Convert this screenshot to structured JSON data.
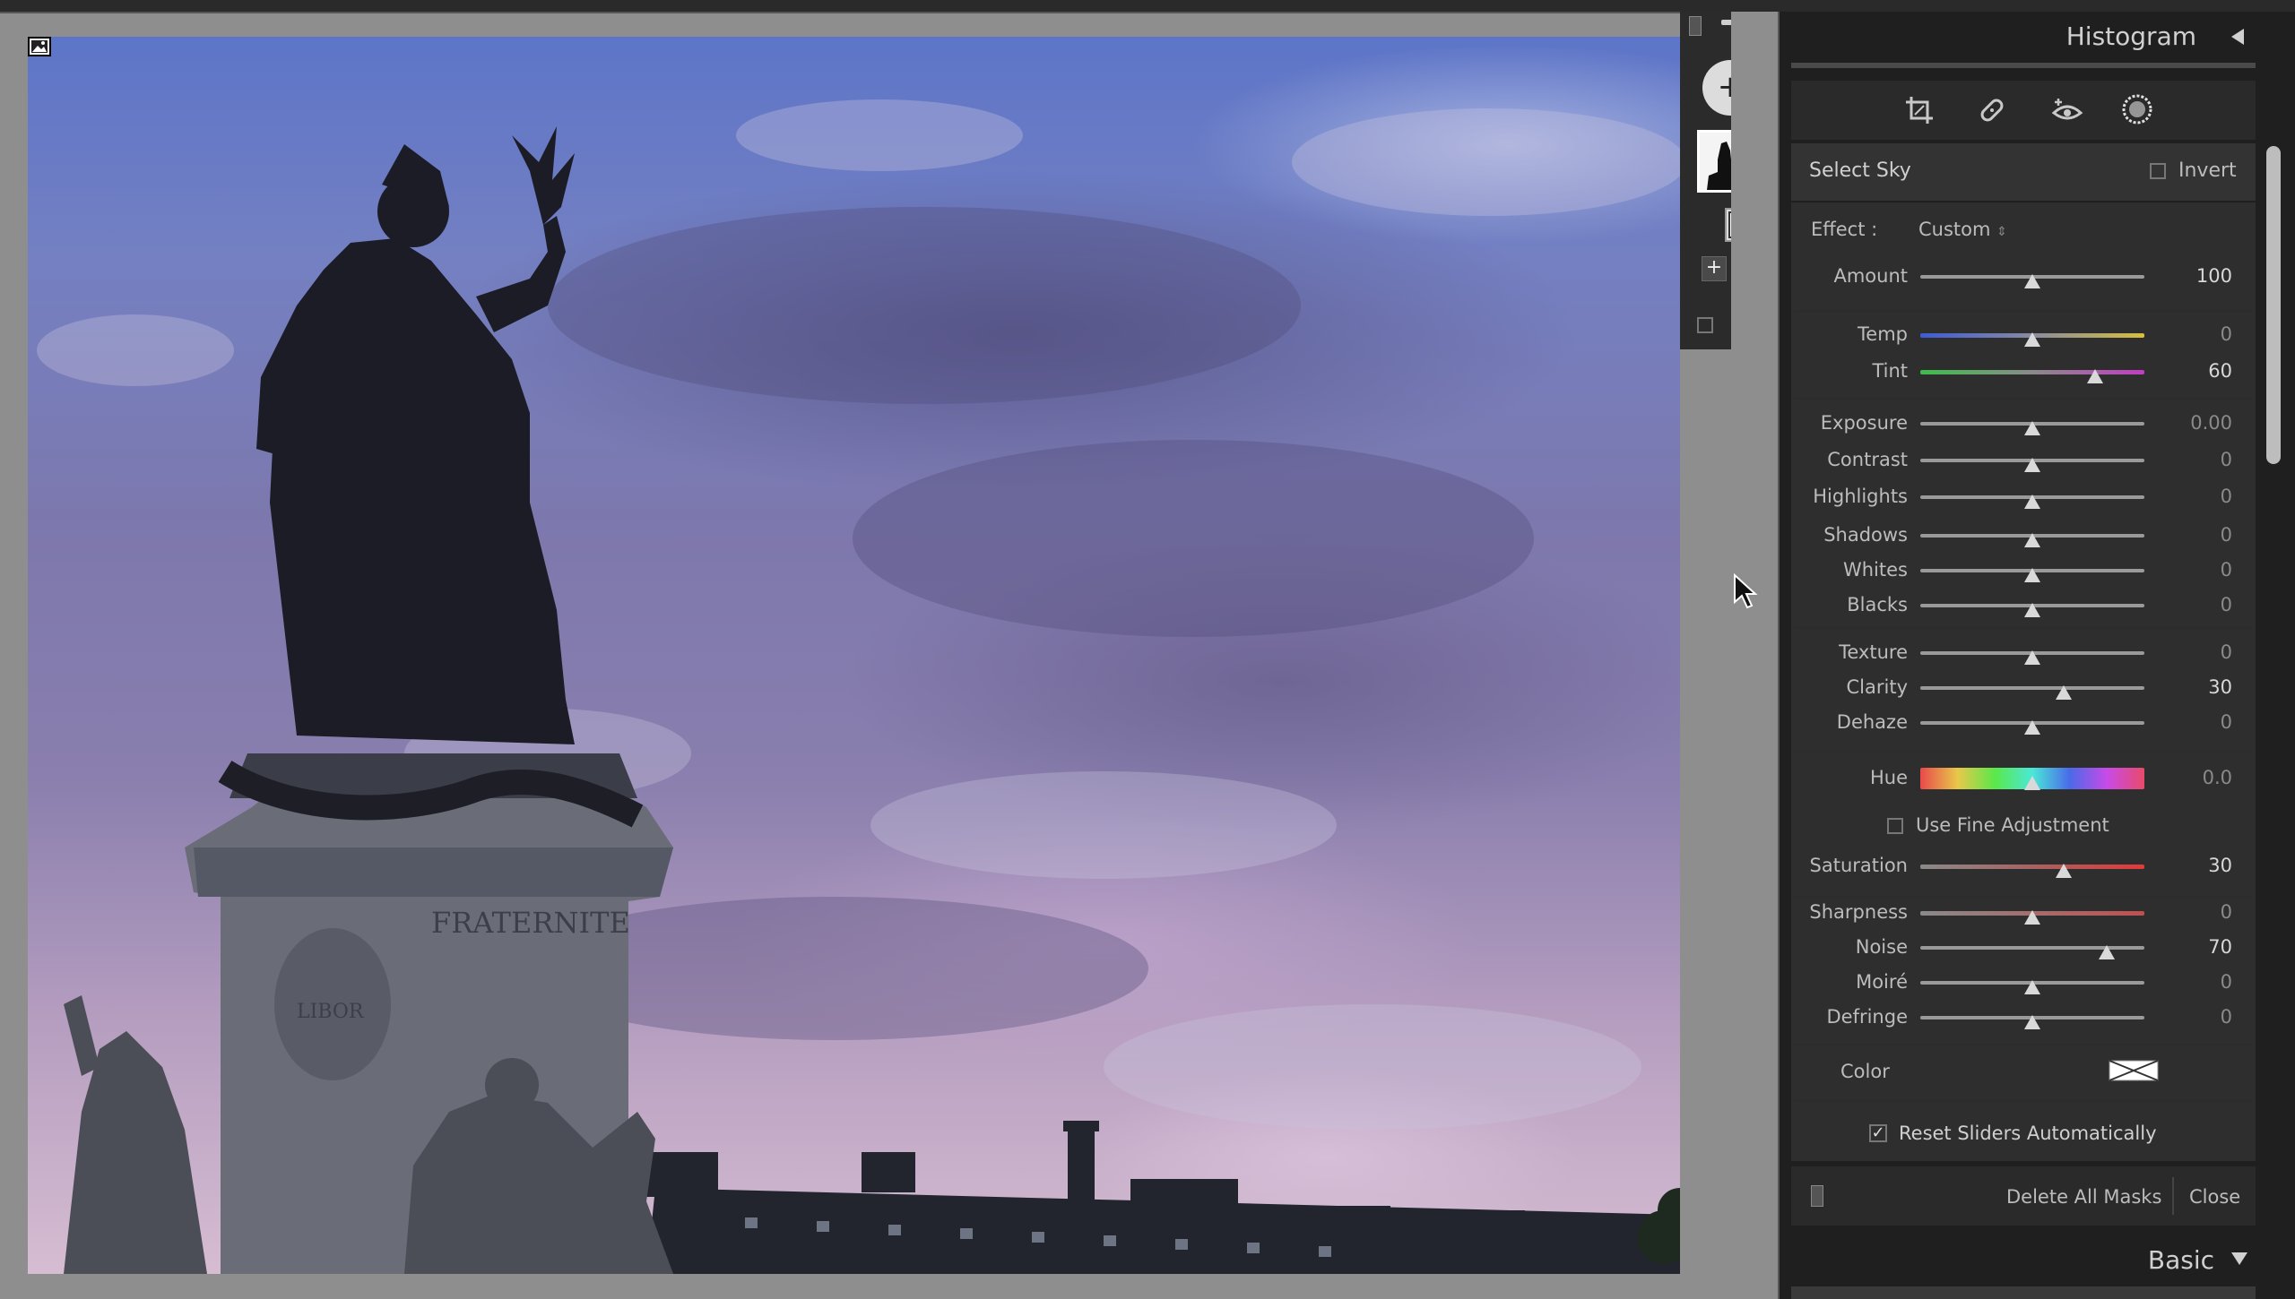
{
  "header": {
    "histogram_label": "Histogram",
    "basic_label": "Basic"
  },
  "mask": {
    "select_sky_label": "Select Sky",
    "invert_label": "Invert",
    "effect_label": "Effect :",
    "effect_value": "Custom"
  },
  "sliders": [
    {
      "label": "Amount",
      "value": "100",
      "pos": 0.5,
      "track": "gray"
    },
    {
      "label": "Temp",
      "value": "0",
      "pos": 0.5,
      "track": "temp"
    },
    {
      "label": "Tint",
      "value": "60",
      "pos": 0.78,
      "track": "tint"
    },
    {
      "label": "Exposure",
      "value": "0.00",
      "pos": 0.5,
      "track": "gray"
    },
    {
      "label": "Contrast",
      "value": "0",
      "pos": 0.5,
      "track": "gray"
    },
    {
      "label": "Highlights",
      "value": "0",
      "pos": 0.5,
      "track": "gray"
    },
    {
      "label": "Shadows",
      "value": "0",
      "pos": 0.5,
      "track": "gray"
    },
    {
      "label": "Whites",
      "value": "0",
      "pos": 0.5,
      "track": "gray"
    },
    {
      "label": "Blacks",
      "value": "0",
      "pos": 0.5,
      "track": "gray"
    },
    {
      "label": "Texture",
      "value": "0",
      "pos": 0.5,
      "track": "gray"
    },
    {
      "label": "Clarity",
      "value": "30",
      "pos": 0.64,
      "track": "gray"
    },
    {
      "label": "Dehaze",
      "value": "0",
      "pos": 0.5,
      "track": "gray"
    },
    {
      "label": "Hue",
      "value": "0.0",
      "pos": 0.5,
      "track": "hue"
    },
    {
      "label": "Saturation",
      "value": "30",
      "pos": 0.64,
      "track": "sat"
    },
    {
      "label": "Sharpness",
      "value": "0",
      "pos": 0.5,
      "track": "sharp"
    },
    {
      "label": "Noise",
      "value": "70",
      "pos": 0.83,
      "track": "gray"
    },
    {
      "label": "Moiré",
      "value": "0",
      "pos": 0.5,
      "track": "gray"
    },
    {
      "label": "Defringe",
      "value": "0",
      "pos": 0.5,
      "track": "gray"
    }
  ],
  "options": {
    "fine_adjustment_label": "Use Fine Adjustment",
    "color_label": "Color",
    "reset_label": "Reset Sliders Automatically"
  },
  "footer": {
    "delete_label": "Delete All Masks",
    "close_label": "Close"
  },
  "photo": {
    "plaque_text": "FRATERNITE",
    "shield_text": "LIBOR"
  },
  "colors": {
    "panel_bg": "#1f1f1f",
    "section_bg": "#2e2e2e",
    "accent_text": "#d8d8d8"
  }
}
